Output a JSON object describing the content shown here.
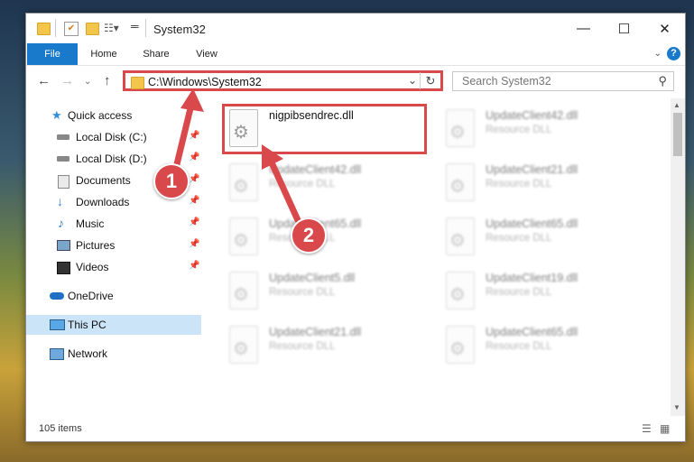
{
  "window": {
    "title": "System32",
    "minimize_glyph": "—",
    "maximize_glyph": "☐",
    "close_glyph": "✕"
  },
  "ribbon": {
    "tabs": [
      {
        "label": "File"
      },
      {
        "label": "Home"
      },
      {
        "label": "Share"
      },
      {
        "label": "View"
      }
    ],
    "help_glyph": "?"
  },
  "address": {
    "path": "C:\\Windows\\System32",
    "search_placeholder": "Search System32"
  },
  "sidebar": {
    "items": [
      {
        "label": "Quick access",
        "icon": "star-icon",
        "pinned": false
      },
      {
        "label": "Local Disk (C:)",
        "icon": "drive-icon",
        "pinned": true
      },
      {
        "label": "Local Disk (D:)",
        "icon": "drive-icon",
        "pinned": true
      },
      {
        "label": "Documents",
        "icon": "documents-icon",
        "pinned": true
      },
      {
        "label": "Downloads",
        "icon": "download-icon",
        "pinned": true
      },
      {
        "label": "Music",
        "icon": "music-icon",
        "pinned": true
      },
      {
        "label": "Pictures",
        "icon": "pictures-icon",
        "pinned": true
      },
      {
        "label": "Videos",
        "icon": "videos-icon",
        "pinned": true
      },
      {
        "label": "OneDrive",
        "icon": "cloud-icon",
        "pinned": false
      },
      {
        "label": "This PC",
        "icon": "computer-icon",
        "pinned": false,
        "selected": true
      },
      {
        "label": "Network",
        "icon": "network-icon",
        "pinned": false
      }
    ]
  },
  "files": [
    {
      "name": "nigpibsendrec.dll",
      "type": "",
      "highlighted": true
    },
    {
      "name": "UpdateClient42.dll",
      "type": "Resource DLL"
    },
    {
      "name": "UpdateClient42.dll",
      "type": "Resource DLL"
    },
    {
      "name": "UpdateClient21.dll",
      "type": "Resource DLL"
    },
    {
      "name": "UpdateClient65.dll",
      "type": "Resource DLL"
    },
    {
      "name": "UpdateClient65.dll",
      "type": "Resource DLL"
    },
    {
      "name": "UpdateClient5.dll",
      "type": "Resource DLL"
    },
    {
      "name": "UpdateClient19.dll",
      "type": "Resource DLL"
    },
    {
      "name": "UpdateClient21.dll",
      "type": "Resource DLL"
    },
    {
      "name": "UpdateClient65.dll",
      "type": "Resource DLL"
    }
  ],
  "status": {
    "item_count": "105 items"
  },
  "annotations": {
    "step1": "1",
    "step2": "2",
    "color": "#d9484b"
  }
}
